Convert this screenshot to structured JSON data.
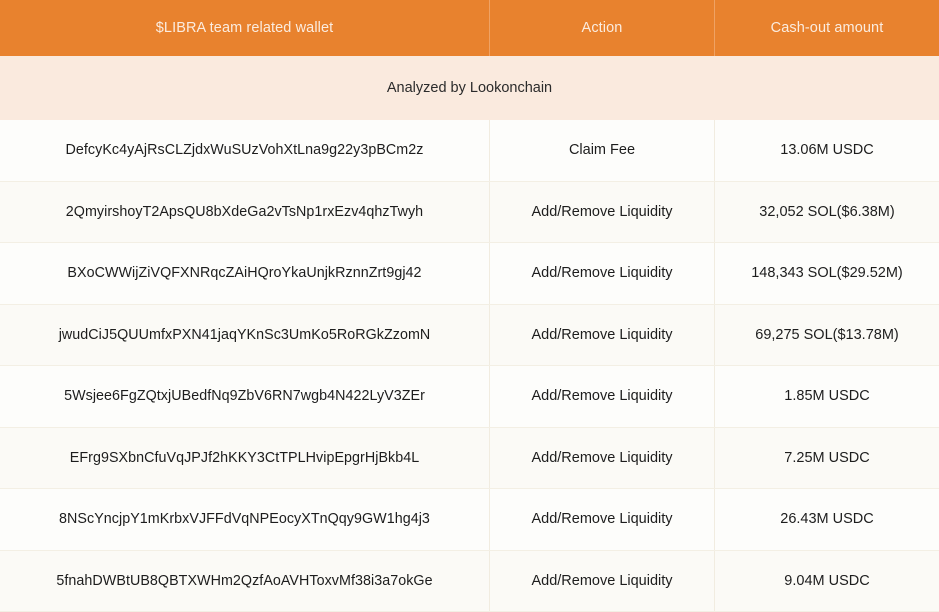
{
  "table": {
    "columns": [
      {
        "key": "wallet",
        "label": "$LIBRA team related wallet"
      },
      {
        "key": "action",
        "label": "Action"
      },
      {
        "key": "amount",
        "label": "Cash-out amount"
      }
    ],
    "subtitle": "Analyzed by Lookonchain",
    "header_bg": "#e8822e",
    "header_text_color": "#fbecdf",
    "subtitle_bg": "#faeade",
    "row_bg": "#fdfdfb",
    "rows": [
      {
        "wallet": "DefcyKc4yAjRsCLZjdxWuSUzVohXtLna9g22y3pBCm2z",
        "action": "Claim Fee",
        "amount": "13.06M USDC"
      },
      {
        "wallet": "2QmyirshoyT2ApsQU8bXdeGa2vTsNp1rxEzv4qhzTwyh",
        "action": "Add/Remove Liquidity",
        "amount": "32,052 SOL($6.38M)"
      },
      {
        "wallet": "BXoCWWijZiVQFXNRqcZAiHQroYkaUnjkRznnZrt9gj42",
        "action": "Add/Remove Liquidity",
        "amount": "148,343 SOL($29.52M)"
      },
      {
        "wallet": "jwudCiJ5QUUmfxPXN41jaqYKnSc3UmKo5RoRGkZzomN",
        "action": "Add/Remove Liquidity",
        "amount": "69,275 SOL($13.78M)"
      },
      {
        "wallet": "5Wsjee6FgZQtxjUBedfNq9ZbV6RN7wgb4N422LyV3ZEr",
        "action": "Add/Remove Liquidity",
        "amount": "1.85M USDC"
      },
      {
        "wallet": "EFrg9SXbnCfuVqJPJf2hKKY3CtTPLHvipEpgrHjBkb4L",
        "action": "Add/Remove Liquidity",
        "amount": "7.25M USDC"
      },
      {
        "wallet": "8NScYncjpY1mKrbxVJFFdVqNPEocyXTnQqy9GW1hg4j3",
        "action": "Add/Remove Liquidity",
        "amount": "26.43M USDC"
      },
      {
        "wallet": "5fnahDWBtUB8QBTXWHm2QzfAoAVHToxvMf38i3a7okGe",
        "action": "Add/Remove Liquidity",
        "amount": "9.04M USDC"
      }
    ]
  }
}
